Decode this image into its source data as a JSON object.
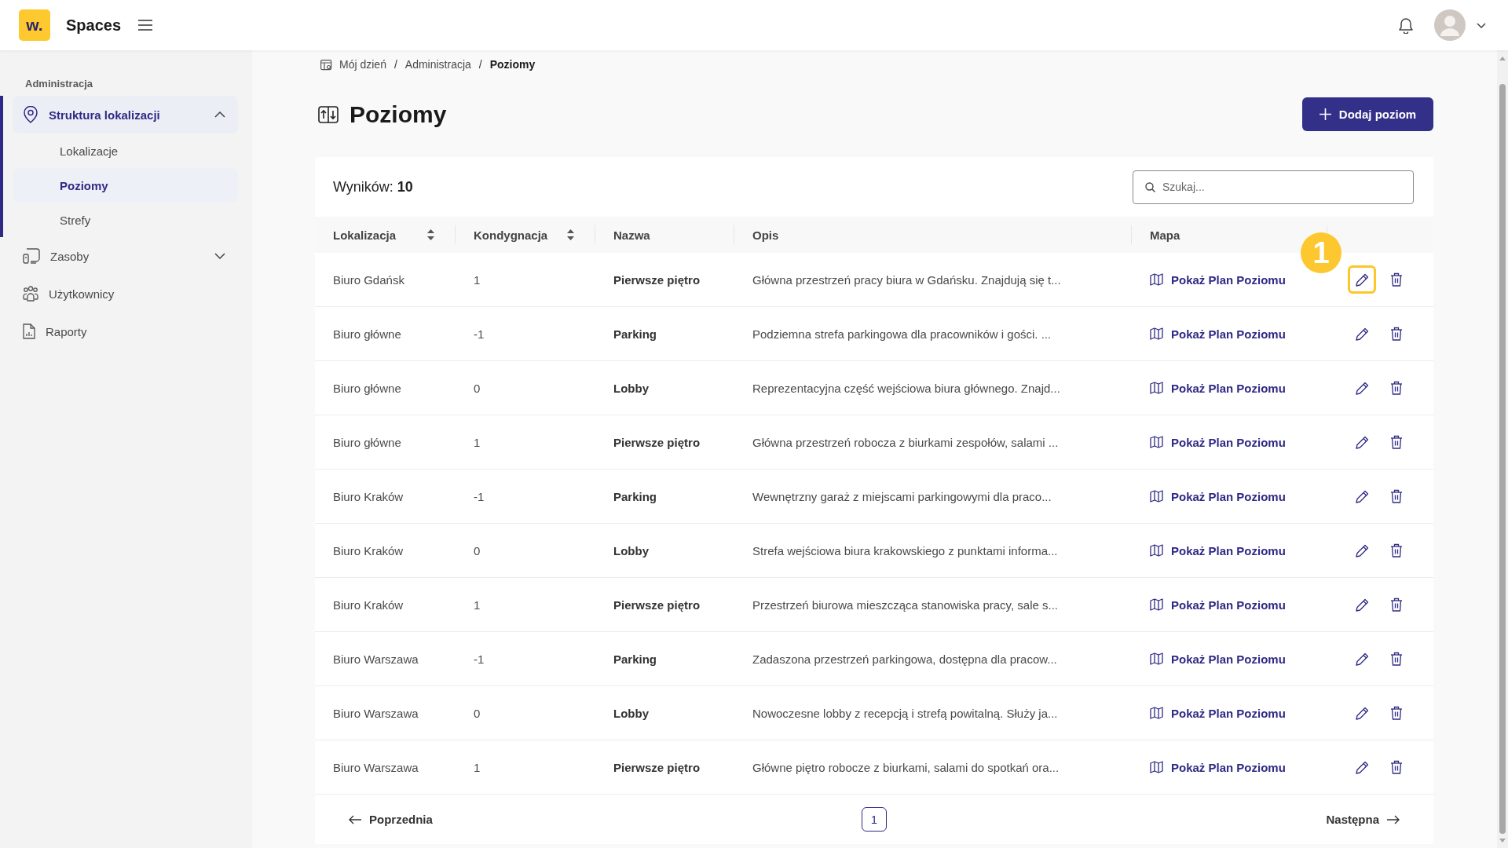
{
  "app": {
    "logo_text": "w.",
    "name": "Spaces"
  },
  "sidebar": {
    "section_label": "Administracja",
    "items": [
      {
        "label": "Struktura lokalizacji",
        "kind": "group",
        "selected": true,
        "expanded": true,
        "children": [
          {
            "label": "Lokalizacje",
            "selected": false
          },
          {
            "label": "Poziomy",
            "selected": true
          },
          {
            "label": "Strefy",
            "selected": false
          }
        ]
      },
      {
        "label": "Zasoby",
        "kind": "group",
        "selected": false,
        "expanded": false
      },
      {
        "label": "Użytkownicy",
        "kind": "link",
        "selected": false
      },
      {
        "label": "Raporty",
        "kind": "link",
        "selected": false
      }
    ]
  },
  "breadcrumb": {
    "items": [
      {
        "label": "Mój dzień",
        "current": false
      },
      {
        "label": "Administracja",
        "current": false
      },
      {
        "label": "Poziomy",
        "current": true
      }
    ],
    "separators": [
      "/",
      "/"
    ]
  },
  "page": {
    "title": "Poziomy",
    "add_button": "Dodaj poziom"
  },
  "results": "Wyników: **10**",
  "search": {
    "placeholder": "Szukaj..."
  },
  "table": {
    "columns": [
      {
        "label": "Lokalizacja",
        "sortable": true
      },
      {
        "label": "Kondygnacja",
        "sortable": true
      },
      {
        "label": "Nazwa",
        "sortable": false
      },
      {
        "label": "Opis",
        "sortable": false
      },
      {
        "label": "Mapa",
        "sortable": false
      }
    ],
    "rows": [
      {
        "location": "Biuro Gdańsk",
        "floor": "1",
        "name": "Pierwsze piętro",
        "description": "Główna przestrzeń pracy biura w Gdańsku. Znajdują się t...",
        "map_link": "Pokaż Plan Poziomu",
        "highlighted": true
      },
      {
        "location": "Biuro główne",
        "floor": "-1",
        "name": "Parking",
        "description": "Podziemna strefa parkingowa dla pracowników i gości. ...",
        "map_link": "Pokaż Plan Poziomu",
        "highlighted": false
      },
      {
        "location": "Biuro główne",
        "floor": "0",
        "name": "Lobby",
        "description": "Reprezentacyjna część wejściowa biura głównego. Znajd...",
        "map_link": "Pokaż Plan Poziomu",
        "highlighted": false
      },
      {
        "location": "Biuro główne",
        "floor": "1",
        "name": "Pierwsze piętro",
        "description": "Główna przestrzeń robocza z biurkami zespołów, salami ...",
        "map_link": "Pokaż Plan Poziomu",
        "highlighted": false
      },
      {
        "location": "Biuro Kraków",
        "floor": "-1",
        "name": "Parking",
        "description": "Wewnętrzny garaż z miejscami parkingowymi dla praco...",
        "map_link": "Pokaż Plan Poziomu",
        "highlighted": false
      },
      {
        "location": "Biuro Kraków",
        "floor": "0",
        "name": "Lobby",
        "description": "Strefa wejściowa biura krakowskiego z punktami informa...",
        "map_link": "Pokaż Plan Poziomu",
        "highlighted": false
      },
      {
        "location": "Biuro Kraków",
        "floor": "1",
        "name": "Pierwsze piętro",
        "description": "Przestrzeń biurowa mieszcząca stanowiska pracy, sale s...",
        "map_link": "Pokaż Plan Poziomu",
        "highlighted": false
      },
      {
        "location": "Biuro Warszawa",
        "floor": "-1",
        "name": "Parking",
        "description": "Zadaszona przestrzeń parkingowa, dostępna dla pracow...",
        "map_link": "Pokaż Plan Poziomu",
        "highlighted": false
      },
      {
        "location": "Biuro Warszawa",
        "floor": "0",
        "name": "Lobby",
        "description": "Nowoczesne lobby z recepcją i strefą powitalną. Służy ja...",
        "map_link": "Pokaż Plan Poziomu",
        "highlighted": false
      },
      {
        "location": "Biuro Warszawa",
        "floor": "1",
        "name": "Pierwsze piętro",
        "description": "Główne piętro robocze z biurkami, salami do spotkań ora...",
        "map_link": "Pokaż Plan Poziomu",
        "highlighted": false
      }
    ]
  },
  "callout": {
    "label": "1"
  },
  "pagination": {
    "previous": "Poprzednia",
    "pages": [
      {
        "label": "1",
        "selected": true
      }
    ],
    "next": "Następna"
  }
}
